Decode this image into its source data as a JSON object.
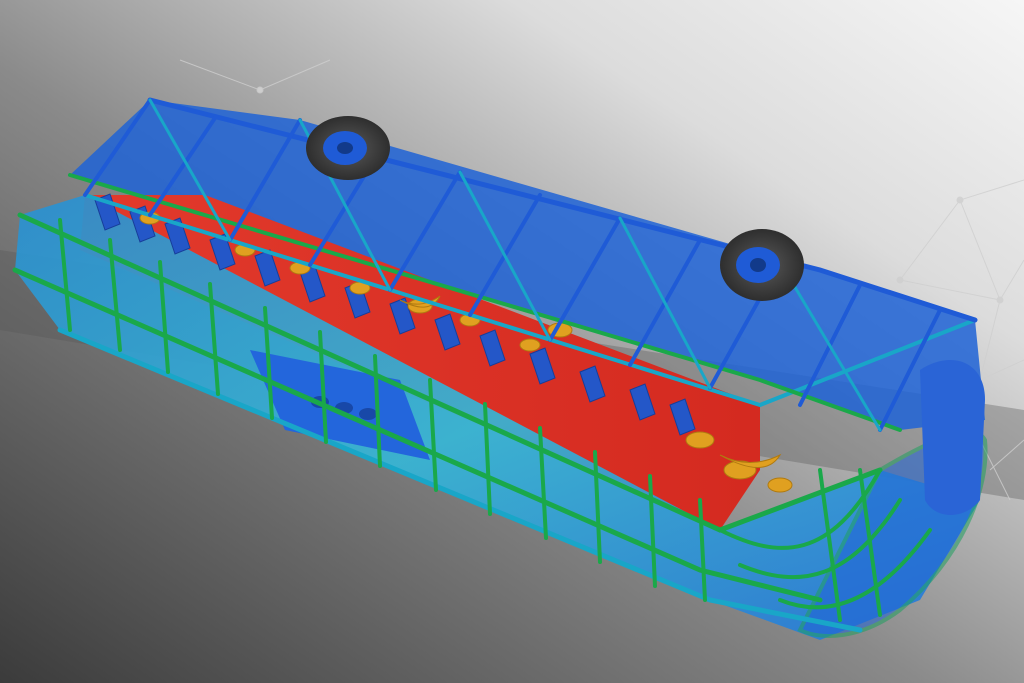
{
  "scene": {
    "subject": "bus-frame-rollover-stress-simulation",
    "colors": {
      "background_dark": "#3a3a3a",
      "background_light": "#f4f4f4",
      "floor": "#dc2f24",
      "frame_high": "#1aa84a",
      "frame_mid": "#19a6c8",
      "frame_low": "#1f5bd6",
      "seat": "#2457c8",
      "occupant": "#e0a020",
      "tire": "#3b3b3b",
      "hub": "#1f5bd6"
    }
  }
}
